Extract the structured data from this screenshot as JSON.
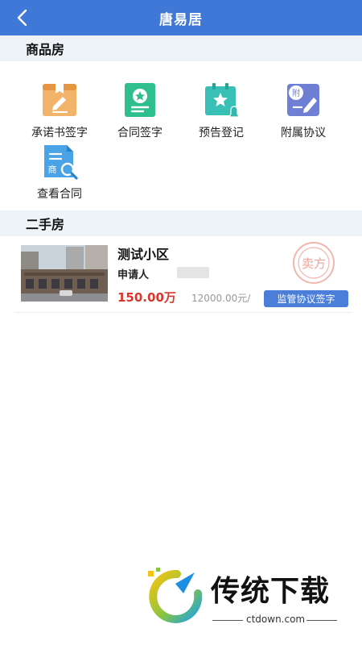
{
  "header": {
    "title": "唐易居"
  },
  "new_house": {
    "heading": "商品房",
    "items": [
      {
        "label": "承诺书签字",
        "icon": "commitment-letter-icon"
      },
      {
        "label": "合同签字",
        "icon": "contract-sign-icon"
      },
      {
        "label": "预告登记",
        "icon": "advance-registration-icon"
      },
      {
        "label": "附属协议",
        "icon": "supplementary-agreement-icon"
      },
      {
        "label": "查看合同",
        "icon": "view-contract-icon",
        "badge": "商"
      }
    ]
  },
  "second_hand": {
    "heading": "二手房",
    "listing": {
      "name": "测试小区",
      "applicant_label": "申请人",
      "total_price": "150.00万",
      "unit_price": "12000.00元/",
      "action": "监管协议签字",
      "stamp": "卖方"
    }
  },
  "watermark": {
    "logo_text": "传统下载",
    "url": "ctdown.com"
  },
  "colors": {
    "header": "#3f78d6",
    "section_bg": "#eef3f8",
    "price": "#d8372d",
    "tag": "#4a7ed9"
  }
}
